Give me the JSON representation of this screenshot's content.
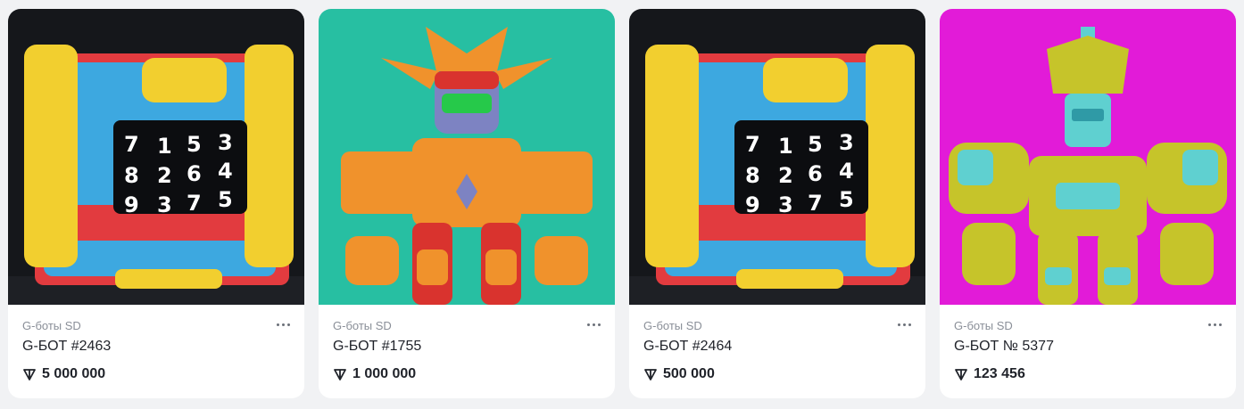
{
  "cards": [
    {
      "collection": "G-боты SD",
      "title": "G-БОТ #2463",
      "price": "5 000 000",
      "art": "cube-lock-bot",
      "bg": "#15171b"
    },
    {
      "collection": "G-боты SD",
      "title": "G-БОТ #1755",
      "price": "1 000 000",
      "art": "orange-robot",
      "bg": "#27bfa2"
    },
    {
      "collection": "G-боты SD",
      "title": "G-БОТ #2464",
      "price": "500 000",
      "art": "cube-lock-bot",
      "bg": "#15171b"
    },
    {
      "collection": "G-боты SD",
      "title": "G-БОТ № 5377",
      "price": "123 456",
      "art": "yellow-robot",
      "bg": "#e21bd8"
    }
  ],
  "cube_digits": [
    [
      "7",
      "8",
      "9"
    ],
    [
      "1",
      "2",
      "3"
    ],
    [
      "5",
      "6",
      "7"
    ],
    [
      "3",
      "4",
      "5"
    ]
  ],
  "price_icon": "ton-icon",
  "menu_icon": "more-dots-icon"
}
